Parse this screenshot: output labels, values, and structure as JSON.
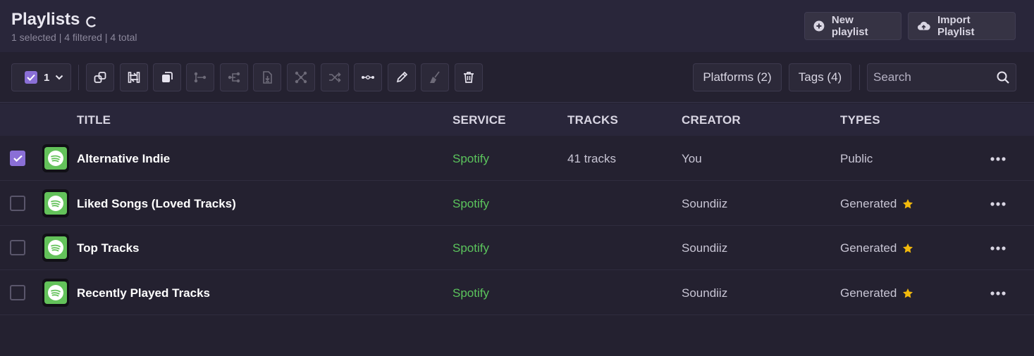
{
  "header": {
    "title": "Playlists",
    "subtitle": "1 selected | 4 filtered | 4 total",
    "new_playlist_label": "New playlist",
    "import_playlist_label": "Import Playlist"
  },
  "toolbar": {
    "selected_count": "1",
    "platforms_label": "Platforms (2)",
    "tags_label": "Tags (4)",
    "search_placeholder": "Search",
    "icons": [
      "link-icon",
      "sync-icon",
      "copy-icon",
      "merge-icon",
      "split-icon",
      "export-icon",
      "network-icon",
      "shuffle-icon",
      "dots-icon",
      "edit-icon",
      "broom-icon",
      "trash-icon"
    ]
  },
  "table": {
    "columns": [
      "TITLE",
      "SERVICE",
      "TRACKS",
      "CREATOR",
      "TYPES"
    ],
    "rows": [
      {
        "checked": true,
        "title": "Alternative Indie",
        "service": "Spotify",
        "tracks": "41 tracks",
        "creator": "You",
        "type": "Public",
        "starred": false
      },
      {
        "checked": false,
        "title": "Liked Songs (Loved Tracks)",
        "service": "Spotify",
        "tracks": "",
        "creator": "Soundiiz",
        "type": "Generated",
        "starred": true
      },
      {
        "checked": false,
        "title": "Top Tracks",
        "service": "Spotify",
        "tracks": "",
        "creator": "Soundiiz",
        "type": "Generated",
        "starred": true
      },
      {
        "checked": false,
        "title": "Recently Played Tracks",
        "service": "Spotify",
        "tracks": "",
        "creator": "Soundiiz",
        "type": "Generated",
        "starred": true
      }
    ]
  },
  "colors": {
    "accent": "#8a6fd6",
    "spotify_green": "#5bc45c",
    "star": "#f2b90c"
  }
}
